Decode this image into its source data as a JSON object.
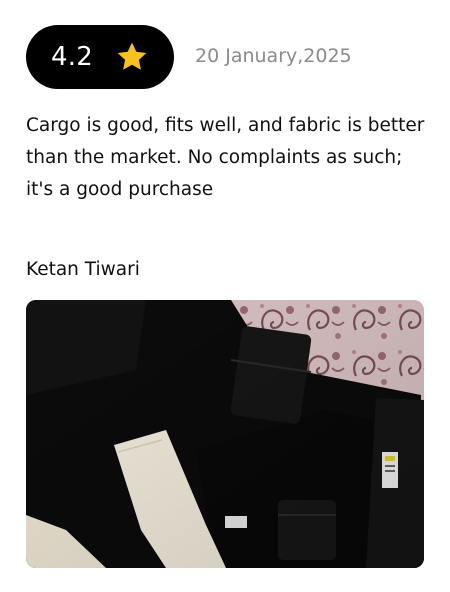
{
  "review": {
    "rating": "4.2",
    "rating_icon": "star-icon",
    "date": "20 January,2025",
    "text": "Cargo is good, fits well, and fabric is better than the market. No complaints as such; it's a good purchase",
    "reviewer": "Ketan Tiwari"
  },
  "photo": {
    "subject": "black cargo pants laid flat on a patterned bedsheet"
  },
  "colors": {
    "pill_background": "#000000",
    "pill_text": "#ffffff",
    "star": "#f7c21b",
    "date_text": "#8b8b8b",
    "body_text": "#111111"
  }
}
